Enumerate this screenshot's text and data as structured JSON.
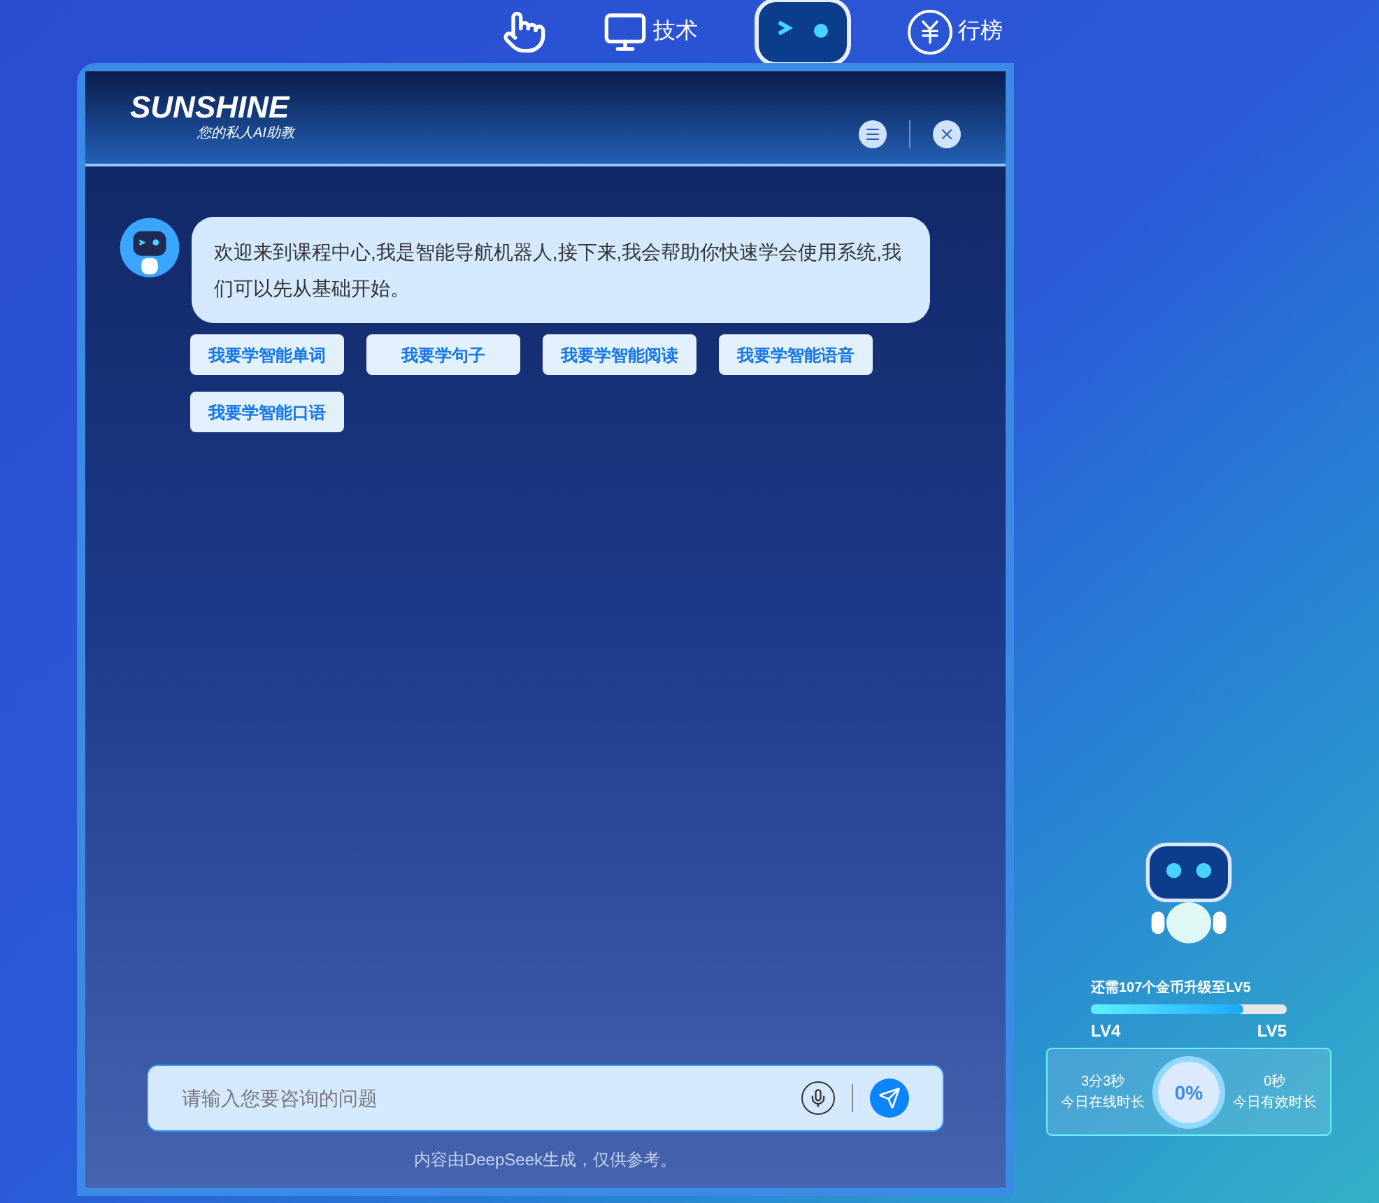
{
  "top_nav": [
    {
      "kind": "hand"
    },
    {
      "kind": "monitor",
      "label": "技术"
    },
    {
      "kind": "robot"
    },
    {
      "kind": "yen",
      "label": "行榜"
    }
  ],
  "dialog": {
    "logo_title": "SUNSHINE",
    "logo_subtitle": "您的私人AI助教"
  },
  "message": {
    "text": "欢迎来到课程中心,我是智能导航机器人,接下来,我会帮助你快速学会使用系统,我们可以先从基础开始。"
  },
  "suggestions": [
    "我要学智能单词",
    "我要学句子",
    "我要学智能阅读",
    "我要学智能语音",
    "我要学智能口语"
  ],
  "input": {
    "placeholder": "请输入您要咨询的问题"
  },
  "disclaimer": "内容由DeepSeek生成，仅供参考。",
  "level_panel": {
    "hint": "还需107个金币升级至LV5",
    "level": 0.78,
    "from": "LV4",
    "to": "LV5"
  },
  "stats": {
    "online_value": "3分3秒",
    "online_label": "今日在线时长",
    "percent": "0%",
    "effective_value": "0秒",
    "effective_label": "今日有效时长"
  }
}
